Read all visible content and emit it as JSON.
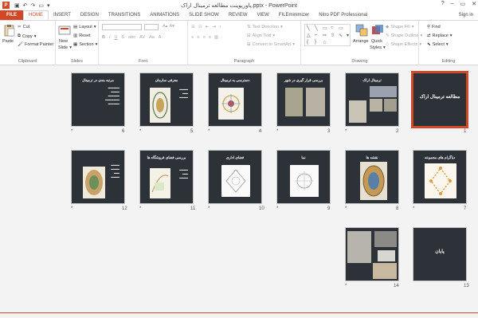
{
  "window": {
    "title": "پاورپوینت مطالعه ترمینال اراک.pptx - PowerPoint",
    "app_icon": "P",
    "controls": [
      "?",
      "–",
      "▭",
      "✕"
    ]
  },
  "tabs": [
    "FILE",
    "HOME",
    "INSERT",
    "DESIGN",
    "TRANSITIONS",
    "ANIMATIONS",
    "SLIDE SHOW",
    "REVIEW",
    "VIEW",
    "FILEminimizer",
    "Nitro PDF Professional"
  ],
  "active_tab": "HOME",
  "sign_in": "Sign in",
  "ribbon": {
    "clipboard": {
      "paste": "Paste",
      "cut": "Cut",
      "copy": "Copy",
      "format_painter": "Format Painter",
      "label": "Clipboard"
    },
    "slides": {
      "new_slide": "New",
      "new_slide2": "Slide",
      "layout": "Layout",
      "reset": "Reset",
      "section": "Section",
      "label": "Slides"
    },
    "font": {
      "label": "Font"
    },
    "paragraph": {
      "text_direction": "Text Direction",
      "align_text": "Align Text",
      "convert": "Convert to SmartArt",
      "label": "Paragraph"
    },
    "drawing": {
      "arrange": "Arrange",
      "quick_styles": "Quick",
      "quick_styles2": "Styles",
      "shape_fill": "Shape Fill",
      "shape_outline": "Shape Outline",
      "shape_effects": "Shape Effects",
      "label": "Drawing"
    },
    "editing": {
      "find": "Find",
      "replace": "Replace",
      "select": "Select",
      "label": "Editing"
    }
  },
  "slides": [
    {
      "num": "1",
      "title": "مطالعه ترمینال اراک",
      "star": ""
    },
    {
      "num": "2",
      "title": "ترمینال اراک",
      "star": "*"
    },
    {
      "num": "3",
      "title": "بررسی قرار گیری در شهر",
      "star": "*"
    },
    {
      "num": "4",
      "title": "دسترسی به ترمینال",
      "star": "*"
    },
    {
      "num": "5",
      "title": "معرفی سازمان",
      "star": "*"
    },
    {
      "num": "6",
      "title": "مرتبه بندی در ترمینال",
      "star": "*"
    },
    {
      "num": "7",
      "title": "دیاگرام های مجموعه",
      "star": "*"
    },
    {
      "num": "8",
      "title": "نقشه ها",
      "star": "*"
    },
    {
      "num": "9",
      "title": "نما",
      "star": "*"
    },
    {
      "num": "10",
      "title": "فضای اداری",
      "star": "*"
    },
    {
      "num": "11",
      "title": "بررسی فضای فروشگاه ها",
      "star": "*"
    },
    {
      "num": "12",
      "title": "",
      "star": "*"
    },
    {
      "num": "13",
      "title": "پایان",
      "star": ""
    },
    {
      "num": "14",
      "title": "",
      "star": "*"
    }
  ]
}
